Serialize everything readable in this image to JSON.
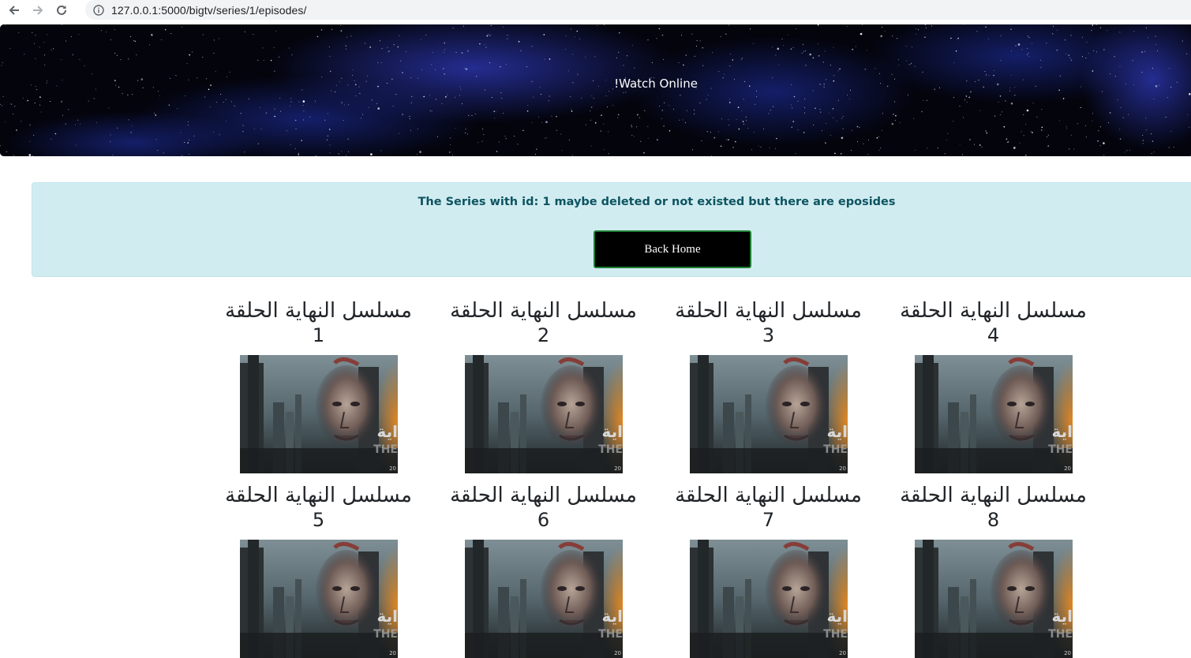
{
  "browser": {
    "url": "127.0.0.1:5000/bigtv/series/1/episodes/"
  },
  "hero": {
    "title": "Watch Online!"
  },
  "alert": {
    "message": "The Series with id: 1 maybe deleted or not existed but there are eposides",
    "back_button": "Back Home"
  },
  "episodes": [
    {
      "title": "مسلسل النهاية الحلقة",
      "number": "1"
    },
    {
      "title": "مسلسل النهاية الحلقة",
      "number": "2"
    },
    {
      "title": "مسلسل النهاية الحلقة",
      "number": "3"
    },
    {
      "title": "مسلسل النهاية الحلقة",
      "number": "4"
    },
    {
      "title": "مسلسل النهاية الحلقة",
      "number": "5"
    },
    {
      "title": "مسلسل النهاية الحلقة",
      "number": "6"
    },
    {
      "title": "مسلسل النهاية الحلقة",
      "number": "7"
    },
    {
      "title": "مسلسل النهاية الحلقة",
      "number": "8"
    }
  ],
  "poster": {
    "text_fragment": "اية",
    "text_fragment_latin": "THE",
    "year_fragment": "20"
  },
  "icons": [
    "back-arrow-icon",
    "forward-arrow-icon",
    "reload-icon",
    "info-icon"
  ],
  "colors": {
    "alert_bg": "#d1ecf1",
    "alert_text": "#0c5460",
    "button_bg": "#000000",
    "button_border": "#1e7e34",
    "hero_bg": "#03040c"
  }
}
